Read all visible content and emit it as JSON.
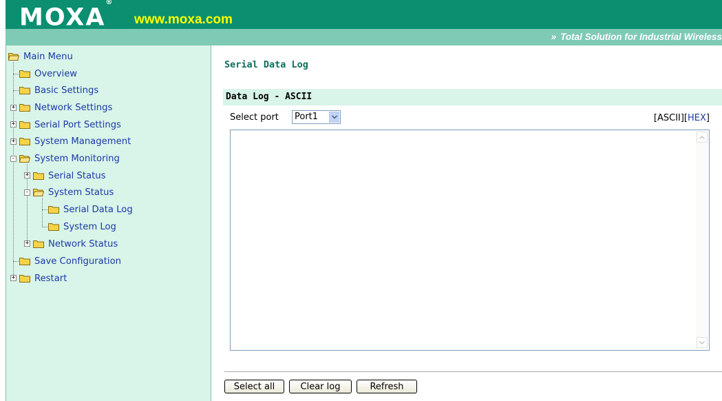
{
  "header": {
    "logo": "MOXA",
    "logo_mark": "®",
    "url": "www.moxa.com",
    "tagline": "Total Solution for Industrial Wireless",
    "tagline_icon": "double-chevron-right"
  },
  "sidebar": {
    "items": [
      {
        "label": "Main Menu",
        "expand": "",
        "state": "open"
      },
      {
        "label": "Overview",
        "expand": "",
        "state": "closed"
      },
      {
        "label": "Basic Settings",
        "expand": "",
        "state": "closed"
      },
      {
        "label": "Network Settings",
        "expand": "+",
        "state": "closed"
      },
      {
        "label": "Serial Port Settings",
        "expand": "+",
        "state": "closed"
      },
      {
        "label": "System Management",
        "expand": "+",
        "state": "closed"
      },
      {
        "label": "System Monitoring",
        "expand": "-",
        "state": "open"
      },
      {
        "label": "Serial Status",
        "expand": "+",
        "state": "closed"
      },
      {
        "label": "System Status",
        "expand": "-",
        "state": "open"
      },
      {
        "label": "Serial Data Log",
        "expand": "",
        "state": "closed"
      },
      {
        "label": "System Log",
        "expand": "",
        "state": "closed"
      },
      {
        "label": "Network Status",
        "expand": "+",
        "state": "closed"
      },
      {
        "label": "Save Configuration",
        "expand": "",
        "state": "closed"
      },
      {
        "label": "Restart",
        "expand": "+",
        "state": "closed"
      }
    ]
  },
  "main": {
    "title": "Serial Data Log",
    "section_title": "Data Log - ASCII",
    "port_label": "Select port",
    "port_value": "Port1",
    "mode_open": "[",
    "mode_ascii": "ASCII",
    "mode_mid": "][",
    "mode_hex": "HEX",
    "mode_close": "]",
    "log_content": "",
    "buttons": {
      "select_all": "Select all",
      "clear_log": "Clear log",
      "refresh": "Refresh"
    }
  },
  "colors": {
    "brand_green": "#0b8f70",
    "brand_light": "#7ecab5",
    "sidebar_bg": "#d9f4e9",
    "link": "#1b3aa8",
    "title_green": "#0e6e5c",
    "url_yellow": "#ffff00"
  }
}
